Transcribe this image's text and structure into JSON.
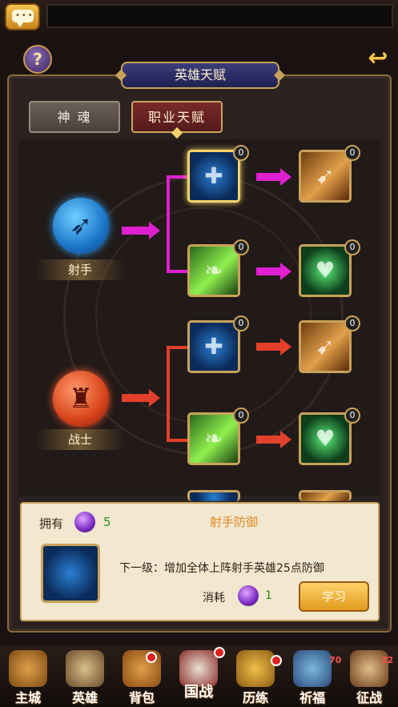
{
  "title": "英雄天赋",
  "tabs": [
    {
      "label": "神 魂",
      "active": false
    },
    {
      "label": "职业天赋",
      "active": true
    }
  ],
  "classes": {
    "archer": {
      "label": "射手",
      "icon": "bow-icon"
    },
    "warrior": {
      "label": "战士",
      "icon": "helmet-icon"
    }
  },
  "skills": {
    "archer_t1_shield": {
      "level": "0",
      "icon": "shield-skill-icon",
      "selected": true
    },
    "archer_t1_wing": {
      "level": "0",
      "icon": "wing-skill-icon"
    },
    "archer_t2_arrow": {
      "level": "0",
      "icon": "arrow-skill-icon"
    },
    "archer_t2_heart": {
      "level": "0",
      "icon": "heart-skill-icon"
    },
    "warrior_t1_shield": {
      "level": "0",
      "icon": "shield-skill-icon"
    },
    "warrior_t1_wing": {
      "level": "0",
      "icon": "wing-skill-icon"
    },
    "warrior_t2_arrow": {
      "level": "0",
      "icon": "arrow-skill-icon"
    },
    "warrior_t2_heart": {
      "level": "0",
      "icon": "heart-skill-icon"
    }
  },
  "info": {
    "own_label": "拥有",
    "own_count": "5",
    "skill_name": "射手防御",
    "description": "下一级：增加全体上阵射手英雄25点防御",
    "cost_label": "消耗",
    "cost_count": "1",
    "learn_button": "学习"
  },
  "nav": [
    {
      "label": "主城",
      "icon": "city-icon"
    },
    {
      "label": "英雄",
      "icon": "hero-icon"
    },
    {
      "label": "背包",
      "icon": "bag-icon",
      "badge": "dot"
    },
    {
      "label": "国战",
      "icon": "war-icon",
      "badge": "dot"
    },
    {
      "label": "历练",
      "icon": "training-icon",
      "badge": "dot"
    },
    {
      "label": "祈福",
      "icon": "blessing-icon",
      "badge": "70"
    },
    {
      "label": "征战",
      "icon": "campaign-icon",
      "badge": "22"
    }
  ],
  "colors": {
    "archer_path": "#e01fd0",
    "warrior_path": "#e2402a",
    "gold_border": "#c9a25a",
    "accent_orange": "#e08a2a",
    "count_green": "#2e8a1f"
  }
}
